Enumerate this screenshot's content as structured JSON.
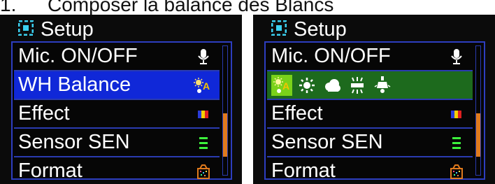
{
  "caption": {
    "prefix": "1.",
    "text": "Composer la balance des Blancs"
  },
  "screens": [
    {
      "title": "Setup",
      "items": [
        {
          "label": "Mic. ON/OFF",
          "icon": "microphone-icon"
        },
        {
          "label": "WH Balance",
          "icon": "white-balance-auto-icon",
          "state": "highlighted"
        },
        {
          "label": "Effect",
          "icon": "color-effect-icon"
        },
        {
          "label": "Sensor SEN",
          "icon": "sensor-sensitivity-icon"
        },
        {
          "label": "Format",
          "icon": "format-memory-card-icon"
        }
      ],
      "scroll_position": 0.6
    },
    {
      "title": "Setup",
      "items": [
        {
          "label": "Mic. ON/OFF",
          "icon": "microphone-icon"
        },
        {
          "label": "",
          "submenu": [
            "auto-wb-icon",
            "sunny-icon",
            "cloudy-icon",
            "fluorescent-icon",
            "incandescent-icon"
          ],
          "state": "expanded"
        },
        {
          "label": "Effect",
          "icon": "color-effect-icon"
        },
        {
          "label": "Sensor SEN",
          "icon": "sensor-sensitivity-icon"
        },
        {
          "label": "Format",
          "icon": "format-memory-card-icon"
        }
      ],
      "scroll_position": 0.6
    }
  ],
  "colors": {
    "selection_blue": "#1028d8",
    "selection_green": "#1d6a1d",
    "active_option": "#7ad21a",
    "menu_border": "#2d3ec0",
    "scroll_thumb": "#e07a1c",
    "setup_icon": "#3bd0f0"
  }
}
